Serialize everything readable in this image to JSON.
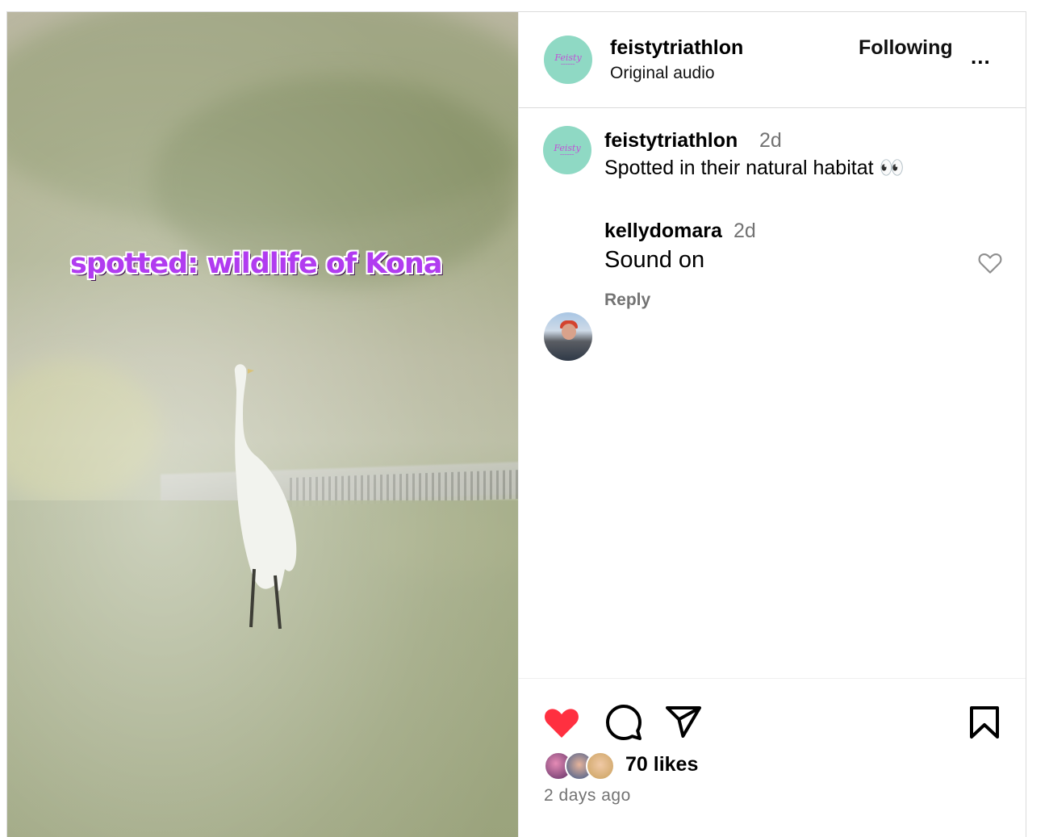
{
  "post": {
    "overlay_caption": "spotted: wildlife of Kona",
    "author": {
      "username": "feistytriathlon",
      "audio": "Original audio",
      "follow_state": "Following",
      "more_label": "..."
    },
    "caption": {
      "username": "feistytriathlon",
      "time": "2d",
      "text": "Spotted in their natural habitat 👀"
    },
    "comments": [
      {
        "username": "kellydomara",
        "time": "2d",
        "text": "Sound on",
        "reply_label": "Reply"
      }
    ],
    "likes_label": "70 likes",
    "posted": "2 days ago",
    "liked": true,
    "colors": {
      "like_red": "#ff3040",
      "overlay_purple": "#b13cf0",
      "avatar_teal": "#8fd9c4",
      "secondary_text": "#737373"
    },
    "icons": [
      "heart-filled-icon",
      "comment-icon",
      "share-icon",
      "bookmark-icon",
      "heart-outline-icon",
      "more-icon"
    ]
  }
}
